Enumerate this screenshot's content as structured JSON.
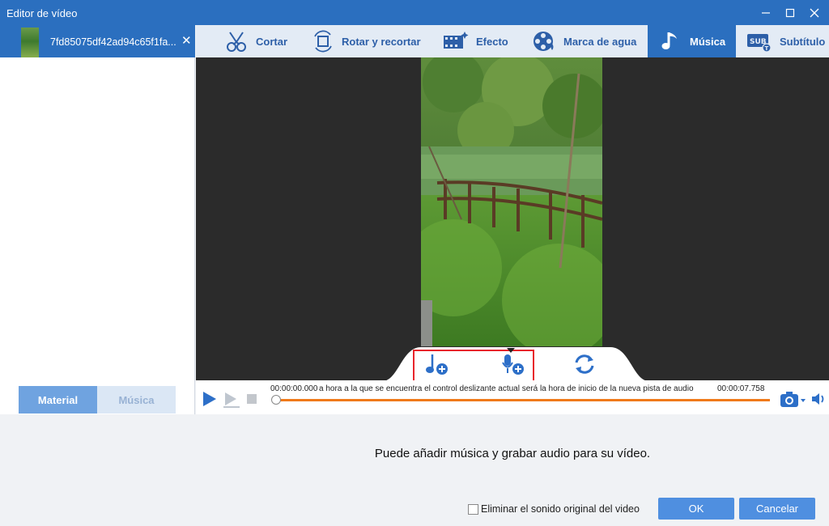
{
  "window": {
    "title": "Editor de vídeo"
  },
  "file_tab": {
    "name": "7fd85075df42ad94c65f1fa..."
  },
  "left_tabs": {
    "material": "Material",
    "music": "Música"
  },
  "toolbar": {
    "cut": "Cortar",
    "rotate_crop": "Rotar y recortar",
    "effect": "Efecto",
    "watermark": "Marca de agua",
    "music": "Música",
    "subtitle": "Subtítulo"
  },
  "player": {
    "time_start": "00:00:00.000",
    "time_end": "00:00:07.758",
    "hint": "a hora a la que se encuentra el control deslizante actual será la hora de inicio de la nueva pista de audio",
    "progress": 0.0
  },
  "dock": {
    "add_music_icon": "music-add-icon",
    "record_audio_icon": "microphone-add-icon",
    "refresh_icon": "refresh-icon"
  },
  "bottom": {
    "message": "Puede añadir música y grabar audio para su vídeo.",
    "remove_original_sound": "Eliminar el sonido original del video",
    "ok": "OK",
    "cancel": "Cancelar"
  },
  "colors": {
    "accent": "#2b6fbf",
    "button": "#4f8fe0",
    "progress": "#f07a1a",
    "highlight": "#e8242b"
  }
}
